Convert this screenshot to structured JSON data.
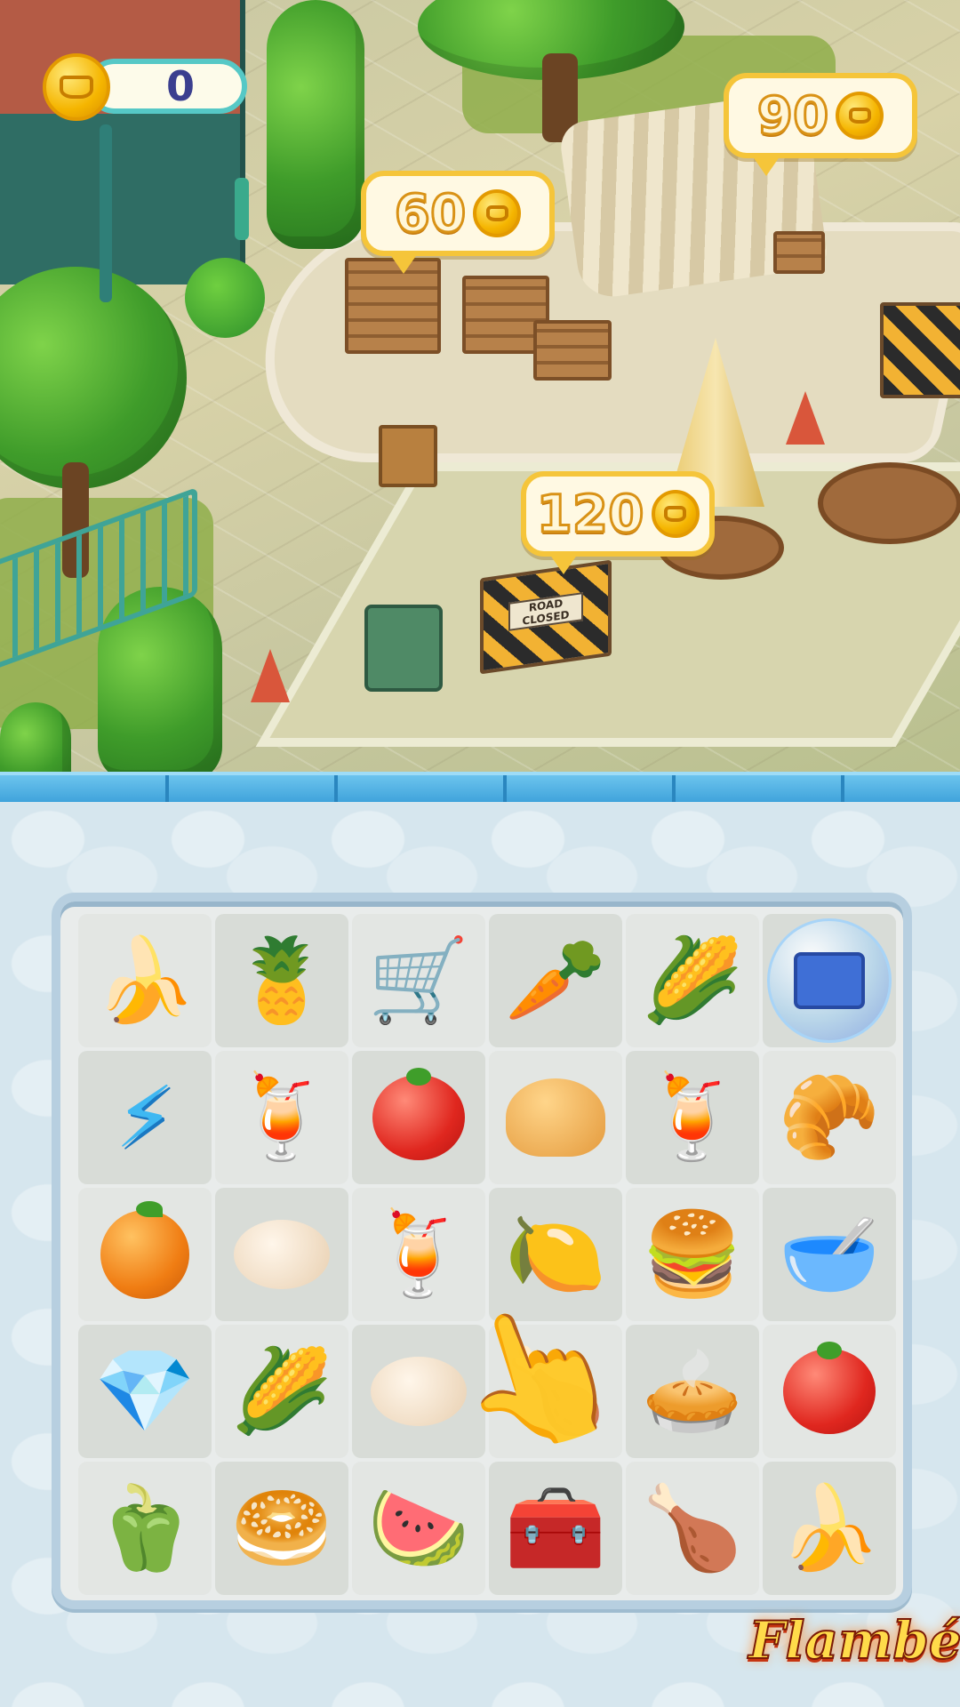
{
  "hud": {
    "coin_count": "0",
    "coin_icon": "coin-icon"
  },
  "scene": {
    "price_bubbles": [
      {
        "label": "60"
      },
      {
        "label": "90"
      },
      {
        "label": "120"
      }
    ],
    "sign_text": "ROAD CLOSED"
  },
  "board": {
    "rows": [
      [
        "banana",
        "pineapple",
        "shopping-cart",
        "carrot",
        "corn",
        "toolbox-bubble"
      ],
      [
        "energy-bolt",
        "fruit-smoothie",
        "tomato",
        "bun",
        "orange-juice",
        "cinnamon-roll"
      ],
      [
        "orange",
        "egg",
        "fruit-smoothie",
        "lemonade",
        "bacon-burger",
        "fruit-granola"
      ],
      [
        "gems",
        "corn",
        "egg",
        "roast-chicken",
        "pie",
        "tomato"
      ],
      [
        "bell-peppers",
        "bagels",
        "watermelon",
        "treasure-chest",
        "roast-chicken",
        "banana"
      ]
    ],
    "glyphs": {
      "banana": "🍌",
      "pineapple": "🍍",
      "shopping-cart": "🛒",
      "carrot": "🥕",
      "corn": "🌽",
      "fruit-smoothie": "🍹",
      "orange-juice": "🍹",
      "cinnamon-roll": "🥐",
      "lemonade": "🍋",
      "bacon-burger": "🍔",
      "fruit-granola": "🥣",
      "gems": "💎",
      "roast-chicken": "🍗",
      "pie": "🥧",
      "bell-peppers": "🫑",
      "bagels": "🥯",
      "watermelon": "🍉",
      "treasure-chest": "🧰"
    }
  },
  "tutorial": {
    "hand_icon": "pointing-hand-icon"
  },
  "branding": {
    "logo_text": "Flambé"
  }
}
